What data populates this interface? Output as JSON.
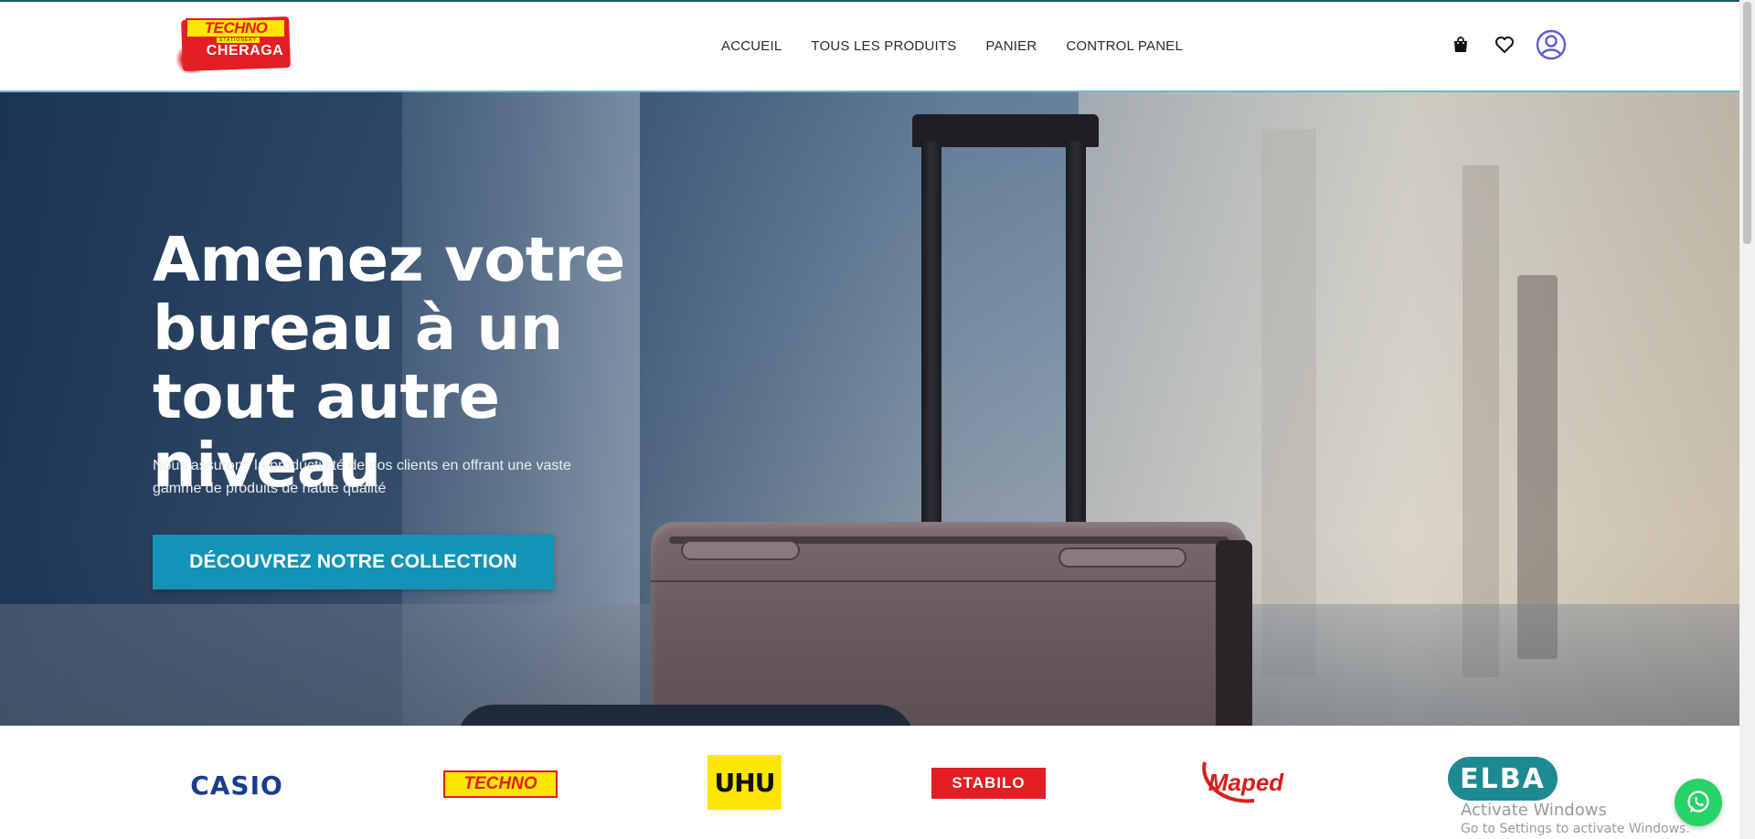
{
  "header": {
    "logo": {
      "brand": "TECHNO",
      "tagline": "STATIONERY",
      "city": "CHERAGA"
    },
    "nav": [
      {
        "label": "ACCUEIL"
      },
      {
        "label": "TOUS LES PRODUITS"
      },
      {
        "label": "PANIER"
      },
      {
        "label": "CONTROL PANEL"
      }
    ],
    "icons": [
      "shopping-bag-icon",
      "heart-icon",
      "user-account-icon"
    ]
  },
  "hero": {
    "title": "Amenez votre bureau à un tout autre niveau",
    "subtitle": "Nous assurons la productivité de nos clients en offrant une vaste gamme de produits de haute qualité",
    "cta_label": "DÉCOUVREZ NOTRE COLLECTION"
  },
  "brands": {
    "casio": "CASIO",
    "techno": "TECHNO",
    "uhu": "UHU",
    "stabilo": "STABILO",
    "maped": "Maped",
    "elba": "ELBA"
  },
  "watermark": {
    "title": "Activate Windows",
    "subtitle": "Go to Settings to activate Windows."
  },
  "colors": {
    "accent": "#1294b6",
    "text_dark": "#2a2a2a",
    "user_icon": "#5b5bd6",
    "whatsapp": "#25d366"
  }
}
